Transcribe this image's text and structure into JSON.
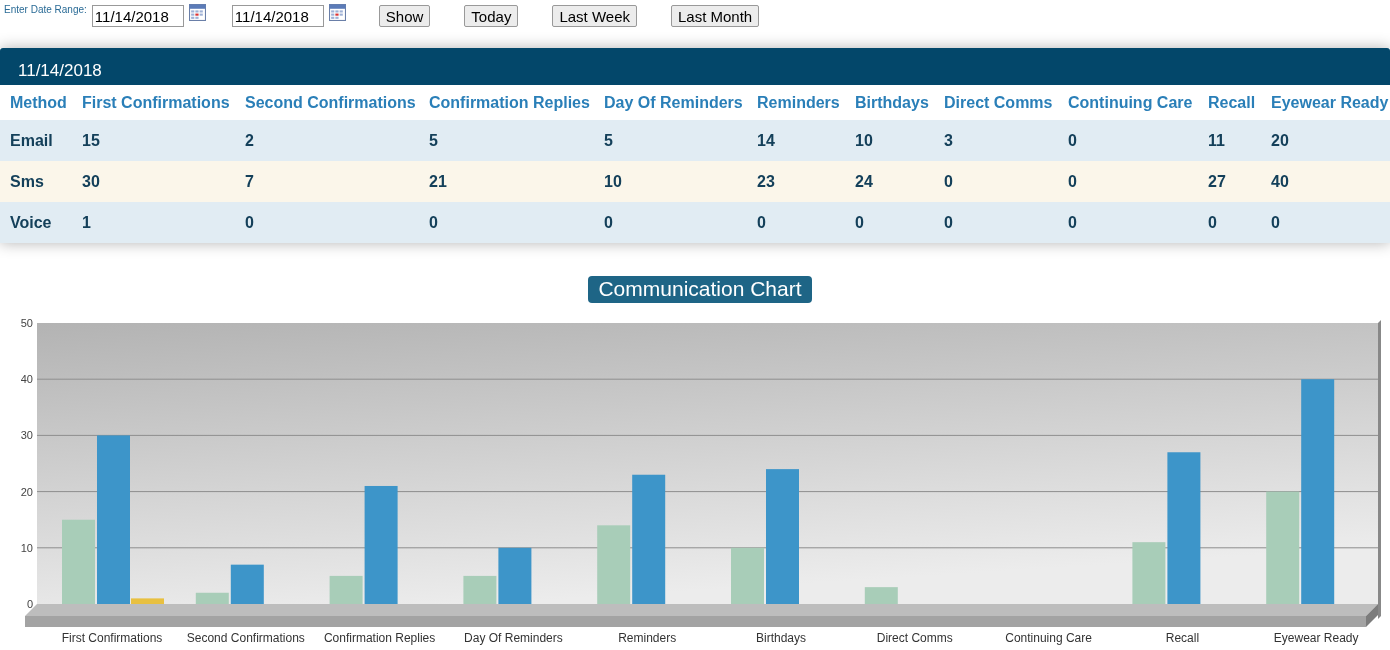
{
  "date_range": {
    "label": "Enter Date Range:",
    "from": "11/14/2018",
    "to": "11/14/2018"
  },
  "buttons": [
    "Show",
    "Today",
    "Last Week",
    "Last Month"
  ],
  "table": {
    "title": "11/14/2018",
    "columns": [
      "Method",
      "First Confirmations",
      "Second Confirmations",
      "Confirmation Replies",
      "Day Of Reminders",
      "Reminders",
      "Birthdays",
      "Direct Comms",
      "Continuing Care",
      "Recall",
      "Eyewear Ready"
    ],
    "rows": [
      {
        "kind": "even",
        "cells": [
          "Email",
          "15",
          "2",
          "5",
          "5",
          "14",
          "10",
          "3",
          "0",
          "11",
          "20"
        ]
      },
      {
        "kind": "odd",
        "cells": [
          "Sms",
          "30",
          "7",
          "21",
          "10",
          "23",
          "24",
          "0",
          "0",
          "27",
          "40"
        ]
      },
      {
        "kind": "even",
        "cells": [
          "Voice",
          "1",
          "0",
          "0",
          "0",
          "0",
          "0",
          "0",
          "0",
          "0",
          "0"
        ]
      }
    ]
  },
  "chart": {
    "title": "Communication Chart",
    "chart_data": {
      "type": "bar",
      "categories": [
        "First Confirmations",
        "Second Confirmations",
        "Confirmation Replies",
        "Day Of Reminders",
        "Reminders",
        "Birthdays",
        "Direct Comms",
        "Continuing Care",
        "Recall",
        "Eyewear Ready"
      ],
      "series": [
        {
          "color": "#a8cdb8",
          "values": [
            15,
            2,
            5,
            5,
            14,
            10,
            3,
            0,
            11,
            20
          ]
        },
        {
          "color": "#3d95c9",
          "values": [
            30,
            7,
            21,
            10,
            23,
            24,
            0,
            0,
            27,
            40
          ]
        },
        {
          "color": "#e8c040",
          "values": [
            1,
            0,
            0,
            0,
            0,
            0,
            0,
            0,
            0,
            0
          ]
        }
      ],
      "ylim": [
        0,
        50
      ],
      "yticks": [
        0,
        10,
        20,
        30,
        40,
        50
      ],
      "grid": true
    }
  }
}
